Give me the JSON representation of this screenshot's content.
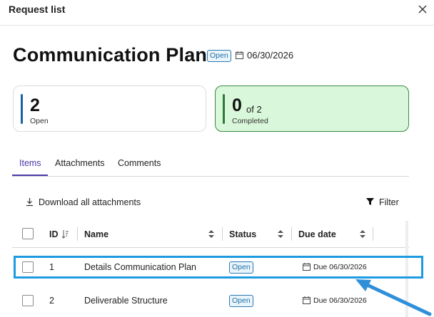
{
  "header": {
    "title": "Request list",
    "close_icon": "close-icon"
  },
  "page": {
    "title": "Communication Plan",
    "status": "Open",
    "due_date": "06/30/2026",
    "calendar_icon": "calendar-icon"
  },
  "summary": {
    "open_count": "2",
    "open_label": "Open",
    "completed_count": "0",
    "completed_of": "of 2",
    "completed_label": "Completed"
  },
  "tabs": [
    {
      "label": "Items",
      "active": true
    },
    {
      "label": "Attachments",
      "active": false
    },
    {
      "label": "Comments",
      "active": false
    }
  ],
  "toolbar": {
    "download_label": "Download all attachments",
    "download_icon": "download-icon",
    "filter_label": "Filter",
    "filter_icon": "filter-icon"
  },
  "table": {
    "columns": [
      "ID",
      "Name",
      "Status",
      "Due date"
    ],
    "rows": [
      {
        "id": "1",
        "name": "Details Communication Plan",
        "status": "Open",
        "due": "Due 06/30/2026"
      },
      {
        "id": "2",
        "name": "Deliverable Structure",
        "status": "Open",
        "due": "Due 06/30/2026"
      }
    ]
  },
  "colors": {
    "accent": "#4a3aa8",
    "status_border": "#2b7bb3",
    "completed_bg": "#d9f7da",
    "highlight": "#1c9be2"
  }
}
